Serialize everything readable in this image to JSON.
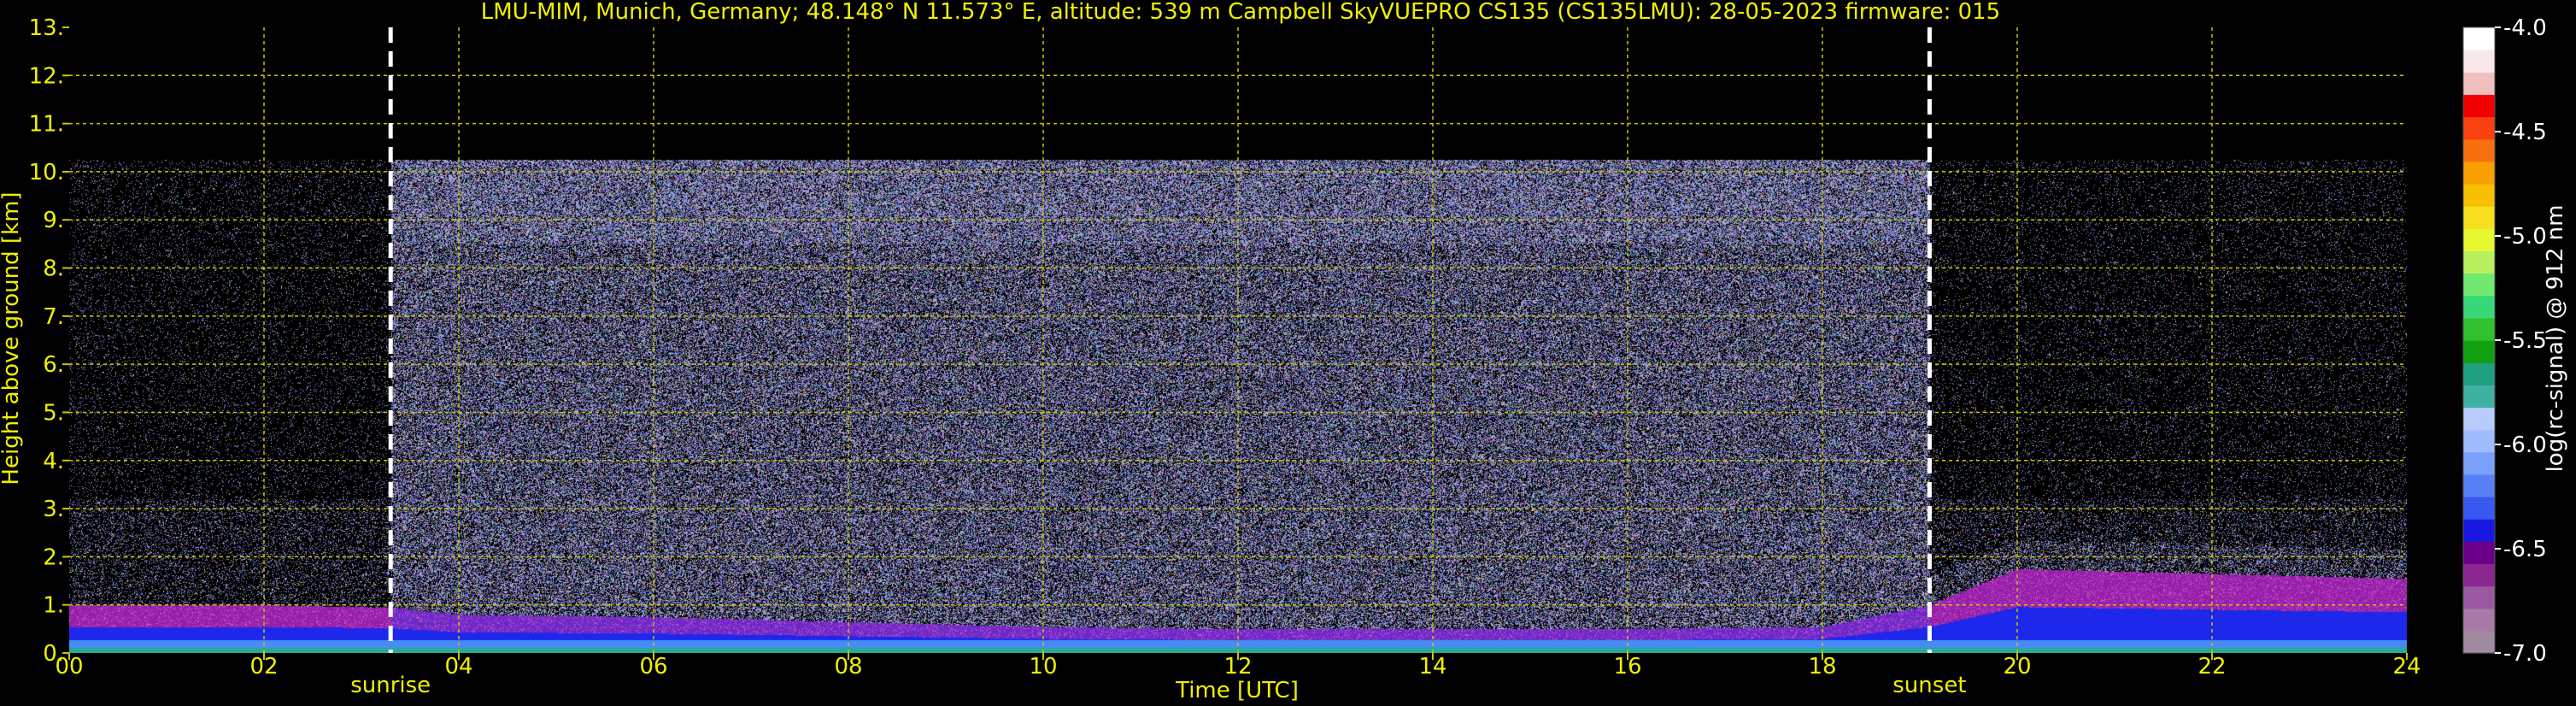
{
  "chart_data": {
    "type": "heatmap",
    "title": "LMU-MIM, Munich, Germany; 48.148° N 11.573° E, altitude: 539 m    Campbell SkyVUEPRO CS135 (CS135LMU): 28-05-2023    firmware: 015",
    "xlabel": "Time [UTC]",
    "ylabel": "Height above ground [km]",
    "colorbar_label": "log(rc-signal) @ 912 nm",
    "xlim": [
      0,
      24
    ],
    "ylim": [
      0,
      13
    ],
    "x_ticks": [
      "00",
      "02",
      "04",
      "06",
      "08",
      "10",
      "12",
      "14",
      "16",
      "18",
      "20",
      "22",
      "24"
    ],
    "y_ticks": [
      "0.",
      "1.",
      "2.",
      "3.",
      "4.",
      "5.",
      "6.",
      "7.",
      "8.",
      "9.",
      "10.",
      "11.",
      "12.",
      "13."
    ],
    "colorbar_range": [
      -7.0,
      -4.0
    ],
    "colorbar_ticks": [
      "-4.0",
      "-4.5",
      "-5.0",
      "-5.5",
      "-6.0",
      "-6.5",
      "-7.0"
    ],
    "colorbar_colors": [
      "#a08aa0",
      "#a87aa8",
      "#9a58a0",
      "#8a2890",
      "#6a008a",
      "#1818e0",
      "#3858f0",
      "#5a80f8",
      "#7aa0fc",
      "#a0bcfc",
      "#b8ccfc",
      "#40b0a0",
      "#20a080",
      "#10a010",
      "#30c030",
      "#38d878",
      "#70e870",
      "#b8f060",
      "#e8f830",
      "#f8e020",
      "#f8c000",
      "#f8a000",
      "#f87010",
      "#f84010",
      "#f00000",
      "#f0c0c0",
      "#f8e8e8",
      "#ffffff"
    ],
    "grid": true,
    "grid_color": "#c8c800",
    "text_color": "#f0f000",
    "data_top_km": 10.25,
    "annotations": [
      {
        "label": "sunrise",
        "x": 3.3
      },
      {
        "label": "sunset",
        "x": 19.1
      }
    ],
    "layer_top_km": [
      {
        "x": 0,
        "y": 1.0
      },
      {
        "x": 2,
        "y": 1.0
      },
      {
        "x": 3.3,
        "y": 0.95
      },
      {
        "x": 4,
        "y": 0.8
      },
      {
        "x": 6,
        "y": 0.75
      },
      {
        "x": 8,
        "y": 0.65
      },
      {
        "x": 10,
        "y": 0.55
      },
      {
        "x": 12,
        "y": 0.5
      },
      {
        "x": 14,
        "y": 0.5
      },
      {
        "x": 16,
        "y": 0.5
      },
      {
        "x": 18,
        "y": 0.55
      },
      {
        "x": 19.1,
        "y": 1.0
      },
      {
        "x": 20,
        "y": 1.75
      },
      {
        "x": 22,
        "y": 1.65
      },
      {
        "x": 24,
        "y": 1.55
      }
    ]
  }
}
